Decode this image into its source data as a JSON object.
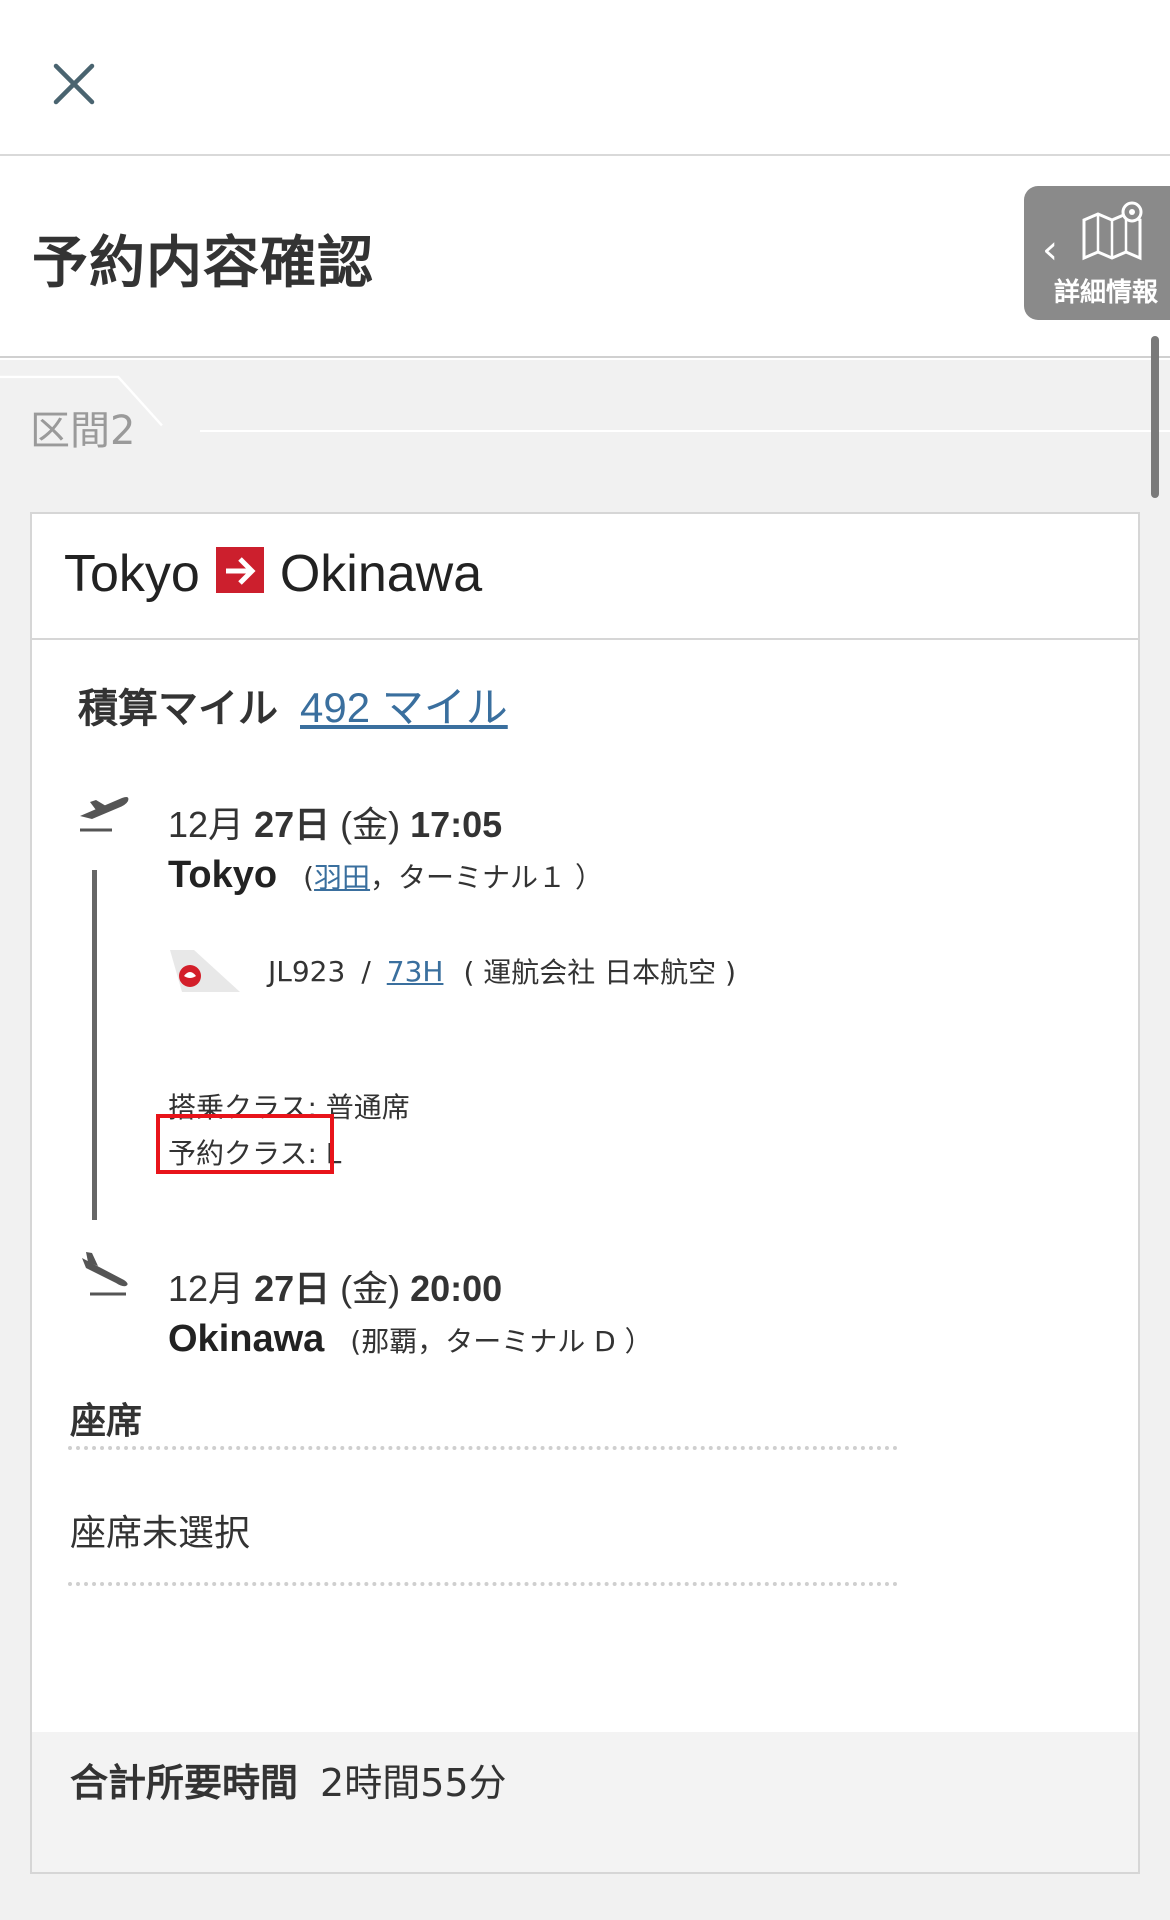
{
  "header": {
    "close_icon": "close-icon",
    "title": "予約内容確認"
  },
  "detail_tab": {
    "label": "詳細情報",
    "icon": "map-icon"
  },
  "segment": {
    "tab_label": "区間2"
  },
  "route": {
    "origin": "Tokyo",
    "destination": "Okinawa",
    "arrow_color": "#cc1f2d"
  },
  "miles": {
    "label": "積算マイル",
    "value": "492 マイル"
  },
  "departure": {
    "date_month": "12月",
    "date_day": "27日",
    "weekday": "(金)",
    "time": "17:05",
    "city": "Tokyo",
    "airport_open": "(",
    "airport": "羽田",
    "terminal": "，ターミナル１ ）"
  },
  "flight": {
    "number": "JL923",
    "separator": "/",
    "aircraft": "73H",
    "operator": "( 運航会社 日本航空 )"
  },
  "classes": {
    "boarding_class": "搭乗クラス: 普通席",
    "booking_class": "予約クラス: L"
  },
  "arrival": {
    "date_month": "12月",
    "date_day": "27日",
    "weekday": "(金)",
    "time": "20:00",
    "city": "Okinawa",
    "airport_text": "(那覇，ターミナル D ）"
  },
  "seat": {
    "title": "座席",
    "value": "座席未選択"
  },
  "total": {
    "label": "合計所要時間",
    "value": "2時間55分"
  }
}
